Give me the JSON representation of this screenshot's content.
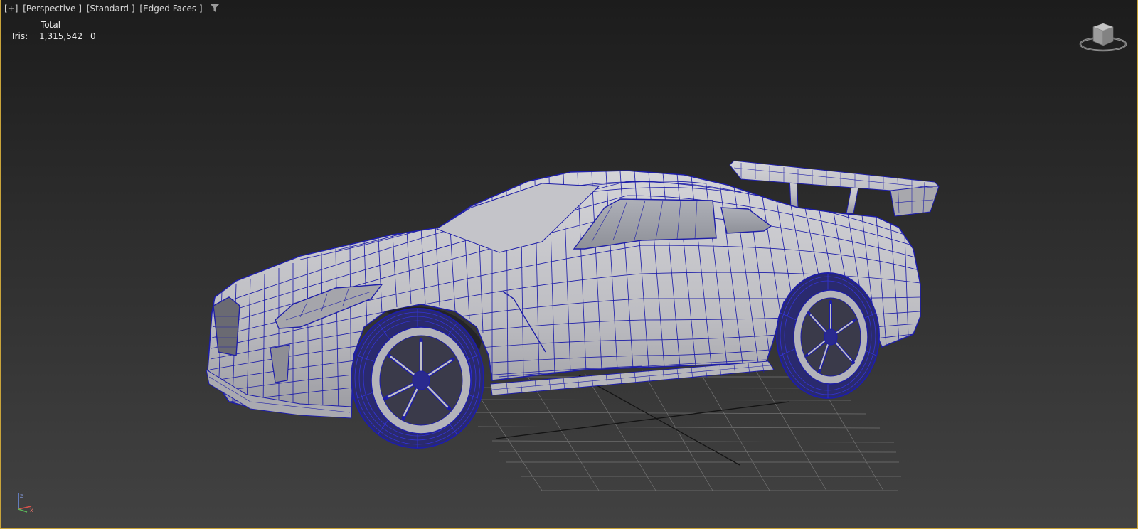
{
  "viewport": {
    "menus": [
      "[+]",
      "[Perspective ]",
      "[Standard ]",
      "[Edged Faces ]"
    ],
    "filter_icon": "funnel-filter-icon",
    "border_color": "#c9a43a",
    "wire_color": "#1e1ea8",
    "surface_color": "#bdbdc2"
  },
  "stats": {
    "header": "Total",
    "label": "Tris:",
    "total": "1,315,542",
    "selected": "0"
  },
  "viewcube": {
    "icon": "viewcube-icon"
  },
  "axis": {
    "icon": "axis-tripod-icon"
  }
}
